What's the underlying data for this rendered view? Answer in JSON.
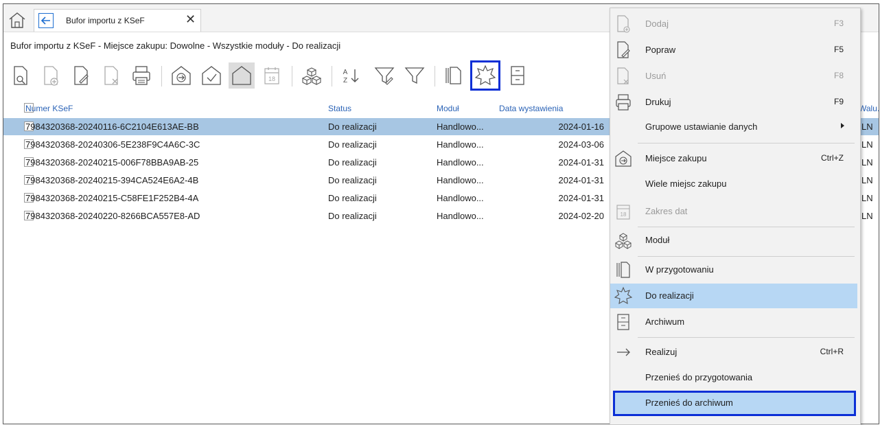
{
  "tab": {
    "title": "Bufor importu z KSeF"
  },
  "subtitle": "Bufor importu z KSeF - Miejsce zakupu: Dowolne - Wszystkie moduły - Do realizacji",
  "columns": {
    "number": "Numer KSeF",
    "status": "Status",
    "module": "Moduł",
    "date": "Data wystawienia",
    "currency": "Walu..."
  },
  "rows": [
    {
      "number": "7984320368-20240116-6C2104E613AE-BB",
      "status": "Do realizacji",
      "module": "Handlowo...",
      "date": "2024-01-16",
      "currency": "LN"
    },
    {
      "number": "7984320368-20240306-5E238F9C4A6C-3C",
      "status": "Do realizacji",
      "module": "Handlowo...",
      "date": "2024-03-06",
      "currency": "LN"
    },
    {
      "number": "7984320368-20240215-006F78BBA9AB-25",
      "status": "Do realizacji",
      "module": "Handlowo...",
      "date": "2024-01-31",
      "currency": "LN"
    },
    {
      "number": "7984320368-20240215-394CA524E6A2-4B",
      "status": "Do realizacji",
      "module": "Handlowo...",
      "date": "2024-01-31",
      "currency": "LN"
    },
    {
      "number": "7984320368-20240215-C58FE1F252B4-4A",
      "status": "Do realizacji",
      "module": "Handlowo...",
      "date": "2024-01-31",
      "currency": "LN"
    },
    {
      "number": "7984320368-20240220-8266BCA557E8-AD",
      "status": "Do realizacji",
      "module": "Handlowo...",
      "date": "2024-02-20",
      "currency": "LN"
    }
  ],
  "toolbar": {
    "date_icon_label": "18",
    "sort_label_a": "A",
    "sort_label_z": "Z"
  },
  "menu": {
    "add": {
      "label": "Dodaj",
      "shortcut": "F3"
    },
    "edit": {
      "label": "Popraw",
      "shortcut": "F5"
    },
    "delete": {
      "label": "Usuń",
      "shortcut": "F8"
    },
    "print": {
      "label": "Drukuj",
      "shortcut": "F9"
    },
    "group_set": {
      "label": "Grupowe ustawianie danych"
    },
    "place": {
      "label": "Miejsce zakupu",
      "shortcut": "Ctrl+Z"
    },
    "many_places": {
      "label": "Wiele miejsc zakupu"
    },
    "date_range": {
      "label": "Zakres dat",
      "icon_text": "18"
    },
    "module": {
      "label": "Moduł"
    },
    "in_preparation": {
      "label": "W przygotowaniu"
    },
    "to_realize": {
      "label": "Do realizacji"
    },
    "archive": {
      "label": "Archiwum"
    },
    "realize": {
      "label": "Realizuj",
      "shortcut": "Ctrl+R"
    },
    "move_prep": {
      "label": "Przenieś do przygotowania"
    },
    "move_archive": {
      "label": "Przenieś do archiwum"
    }
  },
  "colors": {
    "accent": "#1f6fd1",
    "highlight_outline": "#0b2fd6",
    "selected_row": "#a7c6e3",
    "menu_hover": "#b7d7f4"
  }
}
